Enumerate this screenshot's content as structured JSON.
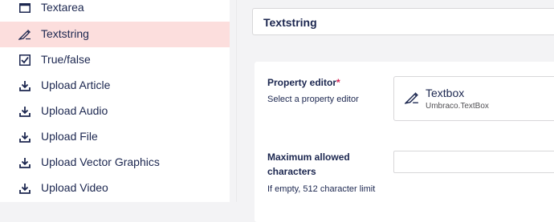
{
  "sidebar": {
    "items": [
      {
        "label": "Textarea",
        "icon": "textarea-icon",
        "active": false
      },
      {
        "label": "Textstring",
        "icon": "edit-text-icon",
        "active": true
      },
      {
        "label": "True/false",
        "icon": "checkbox-icon",
        "active": false
      },
      {
        "label": "Upload Article",
        "icon": "download-icon",
        "active": false
      },
      {
        "label": "Upload Audio",
        "icon": "download-icon",
        "active": false
      },
      {
        "label": "Upload File",
        "icon": "download-icon",
        "active": false
      },
      {
        "label": "Upload Vector Graphics",
        "icon": "download-icon",
        "active": false
      },
      {
        "label": "Upload Video",
        "icon": "download-icon",
        "active": false
      }
    ],
    "active_background": "#fcdedd"
  },
  "header": {
    "name_value": "Textstring"
  },
  "property_editor": {
    "label": "Property editor",
    "required_mark": "*",
    "description": "Select a property editor",
    "selected_name": "Textbox",
    "selected_alias": "Umbraco.TextBox",
    "icon": "edit-text-icon"
  },
  "max_chars": {
    "label": "Maximum allowed characters",
    "description": "If empty, 512 character limit",
    "value": ""
  },
  "colors": {
    "text": "#1b264f",
    "required": "#d42054",
    "border": "#d8d7d9"
  }
}
